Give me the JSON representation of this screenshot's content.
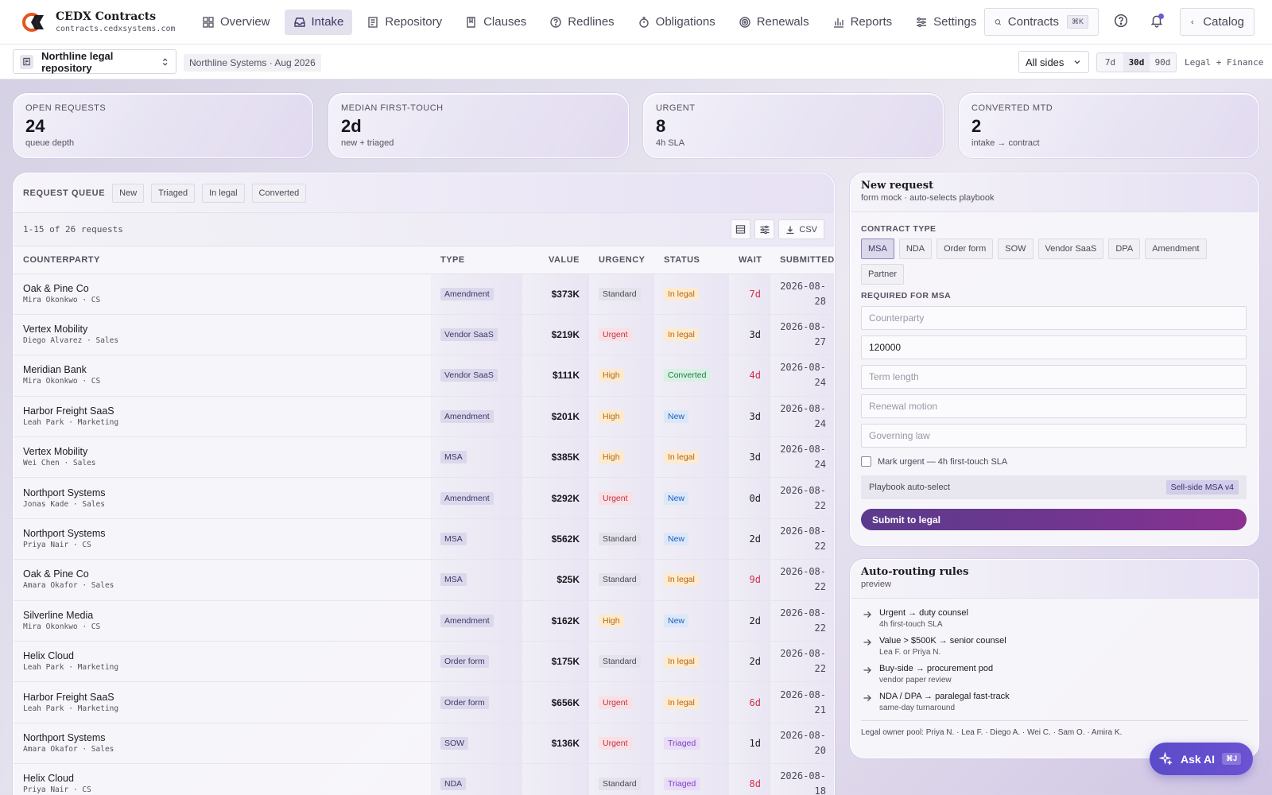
{
  "app": {
    "brand_title": "CEDX Contracts",
    "brand_domain": "contracts.cedxsystems.com"
  },
  "nav": {
    "items": [
      {
        "label": "Overview",
        "icon": "grid-icon"
      },
      {
        "label": "Intake",
        "icon": "inbox-icon",
        "active": true
      },
      {
        "label": "Repository",
        "icon": "repository-icon"
      },
      {
        "label": "Clauses",
        "icon": "clause-book-icon"
      },
      {
        "label": "Redlines",
        "icon": "question-circle-icon"
      },
      {
        "label": "Obligations",
        "icon": "stopwatch-icon"
      },
      {
        "label": "Renewals",
        "icon": "renew-icon"
      },
      {
        "label": "Reports",
        "icon": "bar-chart-icon"
      },
      {
        "label": "Settings",
        "icon": "sliders-icon"
      }
    ],
    "search_label": "Contracts",
    "search_shortcut": "⌘K",
    "catalog_label": "Catalog"
  },
  "subbar": {
    "repository": "Northline legal repository",
    "org_chip": "Northline Systems · Aug 2026",
    "sides_select": "All sides",
    "ranges": [
      {
        "label": "7d",
        "active": false
      },
      {
        "label": "30d",
        "active": true
      },
      {
        "label": "90d",
        "active": false
      }
    ],
    "scope": "Legal + Finance"
  },
  "kpis": [
    {
      "label": "OPEN REQUESTS",
      "value": "24",
      "sub": "queue depth"
    },
    {
      "label": "MEDIAN FIRST-TOUCH",
      "value": "2d",
      "sub": "new + triaged"
    },
    {
      "label": "URGENT",
      "value": "8",
      "sub": "4h SLA"
    },
    {
      "label": "CONVERTED MTD",
      "value": "2",
      "sub": "intake → contract"
    }
  ],
  "queue": {
    "title": "REQUEST QUEUE",
    "filters": [
      "New",
      "Triaged",
      "In legal",
      "Converted"
    ],
    "count_text": "1-15 of 26 requests",
    "csv_label": "CSV",
    "columns": {
      "counterparty": "COUNTERPARTY",
      "type": "TYPE",
      "value": "VALUE",
      "urgency": "URGENCY",
      "status": "STATUS",
      "wait": "WAIT",
      "submitted": "SUBMITTED"
    },
    "rows": [
      {
        "counterparty": "Oak & Pine Co",
        "owner": "Mira Okonkwo · CS",
        "type": "Amendment",
        "value": "$373K",
        "urgency": "Standard",
        "status": "In legal",
        "wait": "7d",
        "late": true,
        "date1": "2026-08-",
        "date2": "28"
      },
      {
        "counterparty": "Vertex Mobility",
        "owner": "Diego Alvarez · Sales",
        "type": "Vendor SaaS",
        "value": "$219K",
        "urgency": "Urgent",
        "status": "In legal",
        "wait": "3d",
        "late": false,
        "date1": "2026-08-",
        "date2": "27"
      },
      {
        "counterparty": "Meridian Bank",
        "owner": "Mira Okonkwo · CS",
        "type": "Vendor SaaS",
        "value": "$111K",
        "urgency": "High",
        "status": "Converted",
        "wait": "4d",
        "late": true,
        "date1": "2026-08-",
        "date2": "24"
      },
      {
        "counterparty": "Harbor Freight SaaS",
        "owner": "Leah Park · Marketing",
        "type": "Amendment",
        "value": "$201K",
        "urgency": "High",
        "status": "New",
        "wait": "3d",
        "late": false,
        "date1": "2026-08-",
        "date2": "24"
      },
      {
        "counterparty": "Vertex Mobility",
        "owner": "Wei Chen · Sales",
        "type": "MSA",
        "value": "$385K",
        "urgency": "High",
        "status": "In legal",
        "wait": "3d",
        "late": false,
        "date1": "2026-08-",
        "date2": "24"
      },
      {
        "counterparty": "Northport Systems",
        "owner": "Jonas Kade · Sales",
        "type": "Amendment",
        "value": "$292K",
        "urgency": "Urgent",
        "status": "New",
        "wait": "0d",
        "late": false,
        "date1": "2026-08-",
        "date2": "22"
      },
      {
        "counterparty": "Northport Systems",
        "owner": "Priya Nair · CS",
        "type": "MSA",
        "value": "$562K",
        "urgency": "Standard",
        "status": "New",
        "wait": "2d",
        "late": false,
        "date1": "2026-08-",
        "date2": "22"
      },
      {
        "counterparty": "Oak & Pine Co",
        "owner": "Amara Okafor · Sales",
        "type": "MSA",
        "value": "$25K",
        "urgency": "Standard",
        "status": "In legal",
        "wait": "9d",
        "late": true,
        "date1": "2026-08-",
        "date2": "22"
      },
      {
        "counterparty": "Silverline Media",
        "owner": "Mira Okonkwo · CS",
        "type": "Amendment",
        "value": "$162K",
        "urgency": "High",
        "status": "New",
        "wait": "2d",
        "late": false,
        "date1": "2026-08-",
        "date2": "22"
      },
      {
        "counterparty": "Helix Cloud",
        "owner": "Leah Park · Marketing",
        "type": "Order form",
        "value": "$175K",
        "urgency": "Standard",
        "status": "In legal",
        "wait": "2d",
        "late": false,
        "date1": "2026-08-",
        "date2": "22"
      },
      {
        "counterparty": "Harbor Freight SaaS",
        "owner": "Leah Park · Marketing",
        "type": "Order form",
        "value": "$656K",
        "urgency": "Urgent",
        "status": "In legal",
        "wait": "6d",
        "late": true,
        "date1": "2026-08-",
        "date2": "21"
      },
      {
        "counterparty": "Northport Systems",
        "owner": "Amara Okafor · Sales",
        "type": "SOW",
        "value": "$136K",
        "urgency": "Urgent",
        "status": "Triaged",
        "wait": "1d",
        "late": false,
        "date1": "2026-08-",
        "date2": "20"
      },
      {
        "counterparty": "Helix Cloud",
        "owner": "Priya Nair · CS",
        "type": "NDA",
        "value": "",
        "urgency": "Standard",
        "status": "Triaged",
        "wait": "8d",
        "late": true,
        "date1": "2026-08-",
        "date2": "18"
      }
    ]
  },
  "new_request": {
    "title": "New request",
    "subtitle": "form mock · auto-selects playbook",
    "contract_type_label": "CONTRACT TYPE",
    "types": [
      {
        "label": "MSA",
        "active": true
      },
      {
        "label": "NDA",
        "active": false
      },
      {
        "label": "Order form",
        "active": false
      },
      {
        "label": "SOW",
        "active": false
      },
      {
        "label": "Vendor SaaS",
        "active": false
      },
      {
        "label": "DPA",
        "active": false
      },
      {
        "label": "Amendment",
        "active": false
      },
      {
        "label": "Partner",
        "active": false
      }
    ],
    "required_label": "REQUIRED FOR MSA",
    "fields": [
      {
        "name": "counterparty-field",
        "placeholder": "Counterparty",
        "value": ""
      },
      {
        "name": "value-field",
        "placeholder": "",
        "value": "120000"
      },
      {
        "name": "term-length-field",
        "placeholder": "Term length",
        "value": ""
      },
      {
        "name": "renewal-motion-field",
        "placeholder": "Renewal motion",
        "value": ""
      },
      {
        "name": "governing-law-field",
        "placeholder": "Governing law",
        "value": ""
      }
    ],
    "urgent_label": "Mark urgent — 4h first-touch SLA",
    "playbook_label": "Playbook auto-select",
    "playbook_value": "Sell-side MSA v4",
    "submit_label": "Submit to legal"
  },
  "routing": {
    "title": "Auto-routing rules",
    "subtitle": "preview",
    "rules": [
      {
        "title": "Urgent → duty counsel",
        "sub": "4h first-touch SLA"
      },
      {
        "title": "Value > $500K → senior counsel",
        "sub": "Lea F. or Priya N."
      },
      {
        "title": "Buy-side → procurement pod",
        "sub": "vendor paper review"
      },
      {
        "title": "NDA / DPA → paralegal fast-track",
        "sub": "same-day turnaround"
      }
    ],
    "pool": "Legal owner pool: Priya N. · Lea F. · Diego A. · Wei C. · Sam O. · Amira K."
  },
  "ask_ai": {
    "label": "Ask AI",
    "shortcut": "⌘J"
  },
  "colors": {
    "accent": "#5a4bc9",
    "submit": "#733590",
    "late_wait": "#d0304a"
  }
}
